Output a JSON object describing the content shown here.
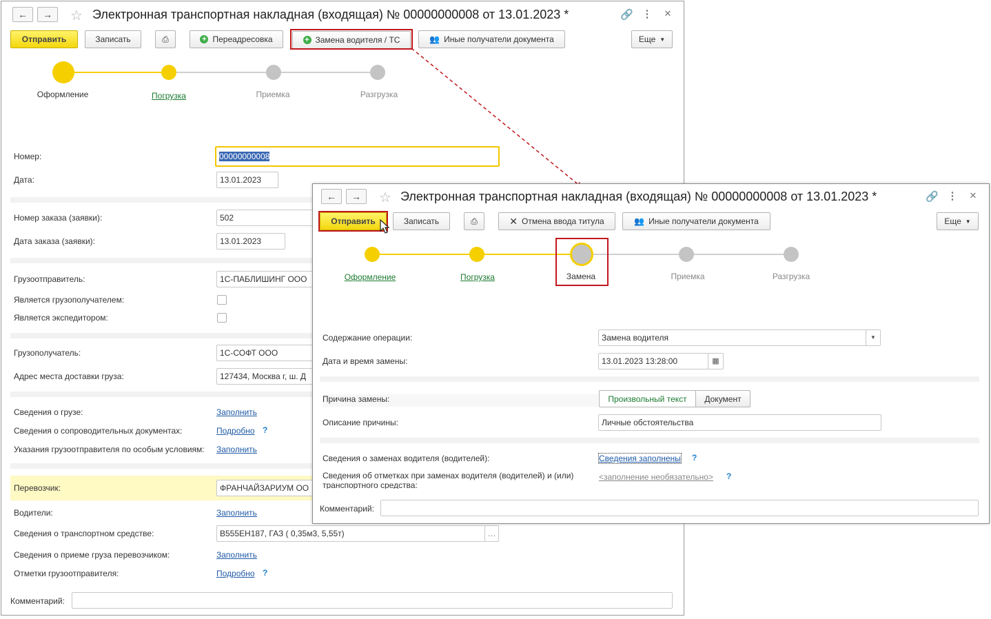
{
  "arrow_color": "#c0161c",
  "window1": {
    "title": "Электронная транспортная накладная (входящая) № 00000000008 от 13.01.2023 *",
    "toolbar": {
      "send": "Отправить",
      "save": "Записать",
      "readdress": "Переадресовка",
      "replace_driver": "Замена водителя / ТС",
      "other_recipients": "Иные получатели документа",
      "more": "Еще"
    },
    "steps": [
      "Оформление",
      "Погрузка",
      "Приемка",
      "Разгрузка"
    ],
    "fields": {
      "number_label": "Номер:",
      "number_value": "00000000008",
      "date_label": "Дата:",
      "date_value": "13.01.2023",
      "order_number_label": "Номер заказа (заявки):",
      "order_number_value": "502",
      "order_date_label": "Дата заказа (заявки):",
      "order_date_value": "13.01.2023",
      "shipper_label": "Грузоотправитель:",
      "shipper_value": "1С-ПАБЛИШИНГ ООО",
      "is_consignee_label": "Является грузополучателем:",
      "is_forwarder_label": "Является экспедитором:",
      "consignee_label": "Грузополучатель:",
      "consignee_value": "1С-СОФТ ООО",
      "delivery_address_label": "Адрес места доставки груза:",
      "delivery_address_value": "127434, Москва г, ш. Д",
      "cargo_info_label": "Сведения о грузе:",
      "cargo_info_link": "Заполнить",
      "docs_info_label": "Сведения о сопроводительных документах:",
      "docs_info_link": "Подробно",
      "special_label": "Указания грузоотправителя по особым условиям:",
      "special_link": "Заполнить",
      "carrier_label": "Перевозчик:",
      "carrier_value": "ФРАНЧАЙЗАРИУМ ОО",
      "drivers_label": "Водители:",
      "drivers_link": "Заполнить",
      "vehicle_label": "Сведения о транспортном средстве:",
      "vehicle_value": "В555ЕН187, ГАЗ ( 0,35м3, 5,55т)",
      "acceptance_label": "Сведения о приеме груза перевозчиком:",
      "acceptance_link": "Заполнить",
      "marks_label": "Отметки грузоотправителя:",
      "marks_link": "Подробно",
      "comment_label": "Комментарий:",
      "q": "?"
    }
  },
  "window2": {
    "title": "Электронная транспортная накладная (входящая) № 00000000008 от 13.01.2023 *",
    "toolbar": {
      "send": "Отправить",
      "save": "Записать",
      "cancel_title": "Отмена ввода титула",
      "other_recipients": "Иные получатели документа",
      "more": "Еще"
    },
    "steps": [
      "Оформление",
      "Погрузка",
      "Замена",
      "Приемка",
      "Разгрузка"
    ],
    "fields": {
      "operation_label": "Содержание операции:",
      "operation_value": "Замена водителя",
      "datetime_label": "Дата и время замены:",
      "datetime_value": "13.01.2023 13:28:00",
      "reason_label": "Причина замены:",
      "reason_option1": "Произвольный текст",
      "reason_option2": "Документ",
      "reason_desc_label": "Описание причины:",
      "reason_desc_value": "Личные обстоятельства",
      "replacements_label": "Сведения о заменах водителя (водителей):",
      "replacements_link": "Сведения заполнены",
      "marks_label": "Сведения об отметках при заменах водителя (водителей) и (или) транспортного средства:",
      "marks_link": "<заполнение необязательно>",
      "comment_label": "Комментарий:",
      "q": "?"
    }
  }
}
